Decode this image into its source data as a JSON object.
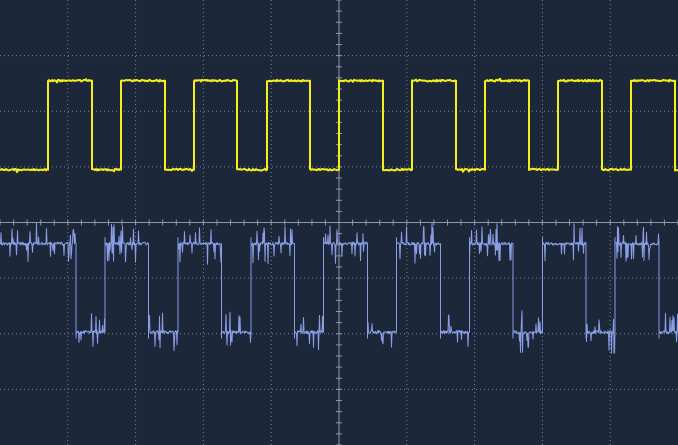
{
  "chart_data": {
    "type": "line",
    "title": "",
    "xlabel": "",
    "ylabel": "",
    "grid": true,
    "divisions": {
      "x": 10,
      "y": 8
    },
    "xlim": [
      0,
      10
    ],
    "ylim": [
      -4,
      4
    ],
    "series": [
      {
        "color": "#f4ee1c",
        "low": 0.95,
        "high": 2.55,
        "period": 1.075,
        "first_rise": 0.7,
        "duty": 0.6,
        "noise": "low"
      },
      {
        "color": "#8fa4ee",
        "low": -1.97,
        "high": -0.38,
        "period": 1.075,
        "first_rise": 0.47,
        "duty": 0.6,
        "noise": "high",
        "first_state_high": true
      }
    ]
  },
  "colors": {
    "background": "#1c273a",
    "grid_dots": "#8a95a8",
    "center_axes": "#97a2b4"
  }
}
